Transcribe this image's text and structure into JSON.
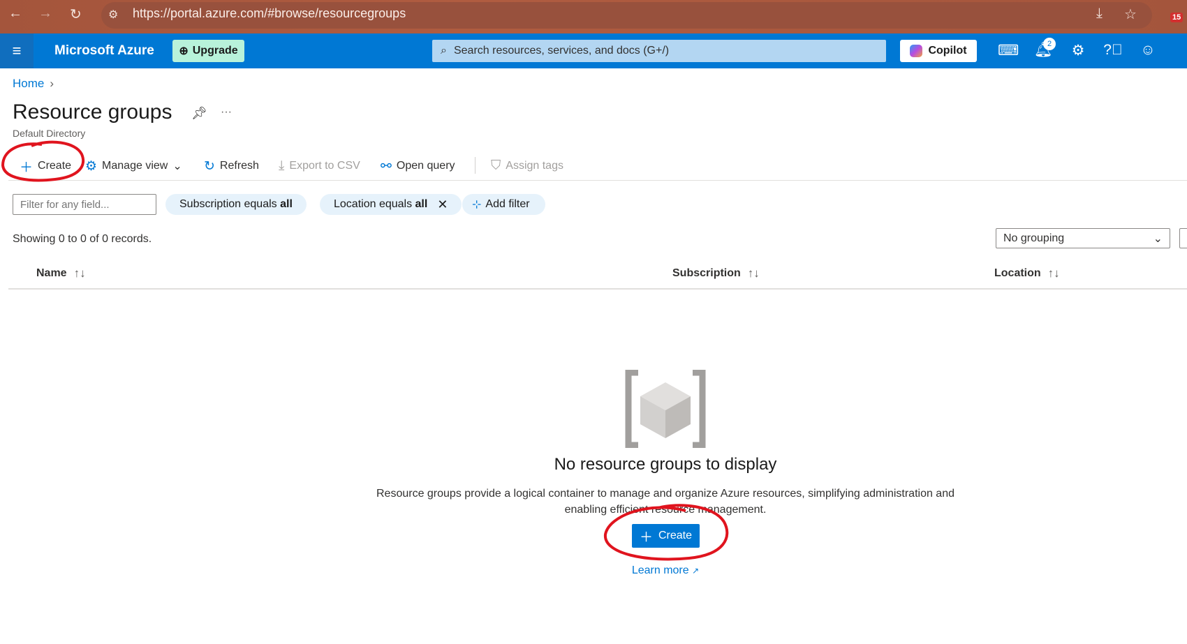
{
  "browser": {
    "url": "https://portal.azure.com/#browse/resourcegroups",
    "extension_badge": "15"
  },
  "header": {
    "brand": "Microsoft Azure",
    "upgrade_label": "Upgrade",
    "search_placeholder": "Search resources, services, and docs (G+/)",
    "copilot_label": "Copilot",
    "notification_count": "2"
  },
  "breadcrumb": {
    "home": "Home"
  },
  "page": {
    "title": "Resource groups",
    "subtitle": "Default Directory",
    "more": "···"
  },
  "toolbar": {
    "create": "Create",
    "manage_view": "Manage view",
    "refresh": "Refresh",
    "export": "Export to CSV",
    "open_query": "Open query",
    "assign_tags": "Assign tags"
  },
  "filters": {
    "placeholder": "Filter for any field...",
    "subscription_prefix": "Subscription equals ",
    "subscription_value": "all",
    "location_prefix": "Location equals ",
    "location_value": "all",
    "add_filter": "Add filter"
  },
  "records": {
    "showing": "Showing 0 to 0 of 0 records.",
    "grouping": "No grouping"
  },
  "table": {
    "columns": [
      "Name",
      "Subscription",
      "Location"
    ]
  },
  "empty": {
    "title": "No resource groups to display",
    "description": "Resource groups provide a logical container to manage and organize Azure resources, simplifying administration and enabling efficient resource management.",
    "create": "Create",
    "learn_more": "Learn more"
  },
  "colors": {
    "accent": "#0078d4",
    "annotation": "#e0141e"
  }
}
